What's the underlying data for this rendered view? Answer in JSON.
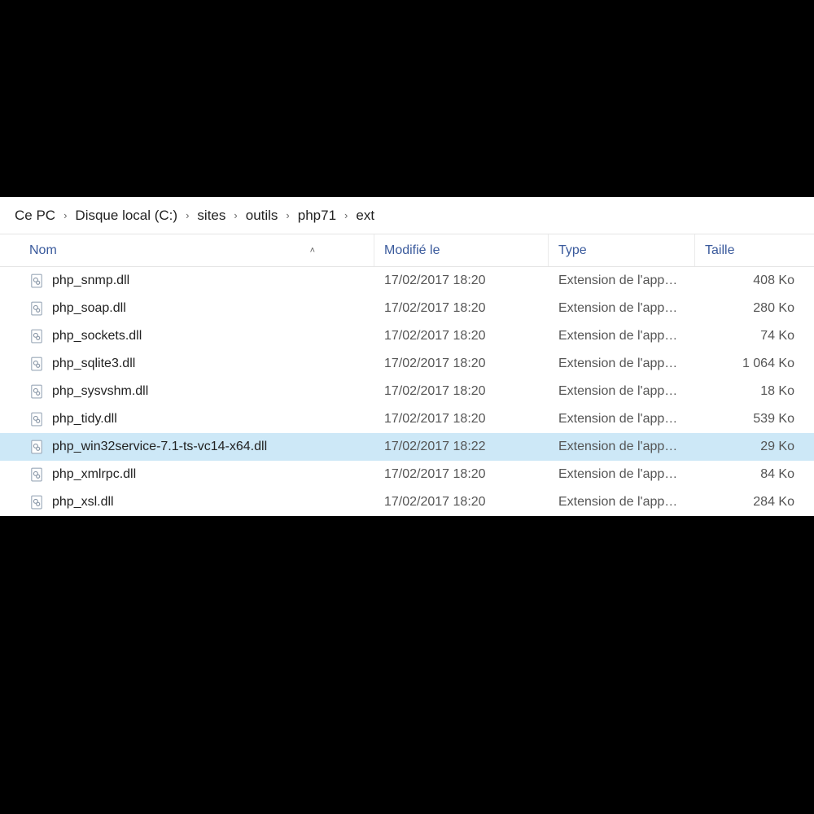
{
  "breadcrumb": [
    "Ce PC",
    "Disque local (C:)",
    "sites",
    "outils",
    "php71",
    "ext"
  ],
  "columns": {
    "name": "Nom",
    "modified": "Modifié le",
    "type": "Type",
    "size": "Taille",
    "sort_indicator": "˄"
  },
  "files": [
    {
      "name": "php_snmp.dll",
      "modified": "17/02/2017 18:20",
      "type": "Extension de l'app…",
      "size": "408 Ko",
      "selected": false
    },
    {
      "name": "php_soap.dll",
      "modified": "17/02/2017 18:20",
      "type": "Extension de l'app…",
      "size": "280 Ko",
      "selected": false
    },
    {
      "name": "php_sockets.dll",
      "modified": "17/02/2017 18:20",
      "type": "Extension de l'app…",
      "size": "74 Ko",
      "selected": false
    },
    {
      "name": "php_sqlite3.dll",
      "modified": "17/02/2017 18:20",
      "type": "Extension de l'app…",
      "size": "1 064 Ko",
      "selected": false
    },
    {
      "name": "php_sysvshm.dll",
      "modified": "17/02/2017 18:20",
      "type": "Extension de l'app…",
      "size": "18 Ko",
      "selected": false
    },
    {
      "name": "php_tidy.dll",
      "modified": "17/02/2017 18:20",
      "type": "Extension de l'app…",
      "size": "539 Ko",
      "selected": false
    },
    {
      "name": "php_win32service-7.1-ts-vc14-x64.dll",
      "modified": "17/02/2017 18:22",
      "type": "Extension de l'app…",
      "size": "29 Ko",
      "selected": true
    },
    {
      "name": "php_xmlrpc.dll",
      "modified": "17/02/2017 18:20",
      "type": "Extension de l'app…",
      "size": "84 Ko",
      "selected": false
    },
    {
      "name": "php_xsl.dll",
      "modified": "17/02/2017 18:20",
      "type": "Extension de l'app…",
      "size": "284 Ko",
      "selected": false
    }
  ]
}
